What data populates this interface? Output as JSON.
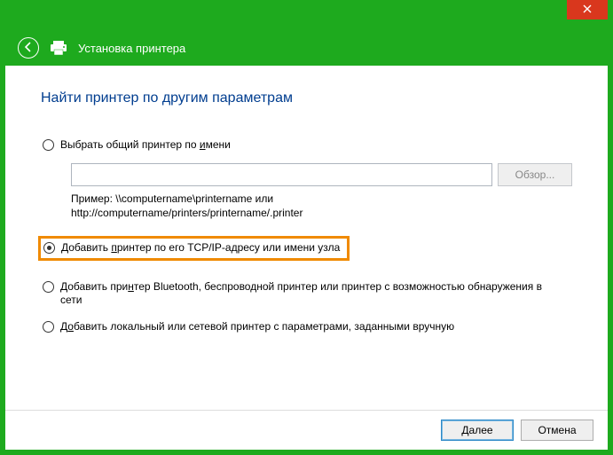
{
  "window": {
    "title": "Установка принтера"
  },
  "page": {
    "heading": "Найти принтер по другим параметрам"
  },
  "options": {
    "by_name": {
      "label_pre": "Выбрать общий принтер по ",
      "label_u": "и",
      "label_post": "мени"
    },
    "tcpip": {
      "label_pre": "Добавить ",
      "label_u": "п",
      "label_post": "ринтер по его TCP/IP-адресу или имени узла"
    },
    "bt": {
      "label_pre": "Добавить при",
      "label_u": "н",
      "label_post": "тер Bluetooth, беспроводной принтер или принтер с возможностью обнаружения в сети"
    },
    "local": {
      "label_pre": "Д",
      "label_u": "о",
      "label_post": "бавить локальный или сетевой принтер с параметрами, заданными вручную"
    }
  },
  "name_input": {
    "value": "",
    "placeholder": ""
  },
  "browse_label": "Обзор...",
  "example": {
    "line1": "Пример: \\\\computername\\printername или",
    "line2": "http://computername/printers/printername/.printer"
  },
  "footer": {
    "next": "Далее",
    "cancel": "Отмена"
  }
}
